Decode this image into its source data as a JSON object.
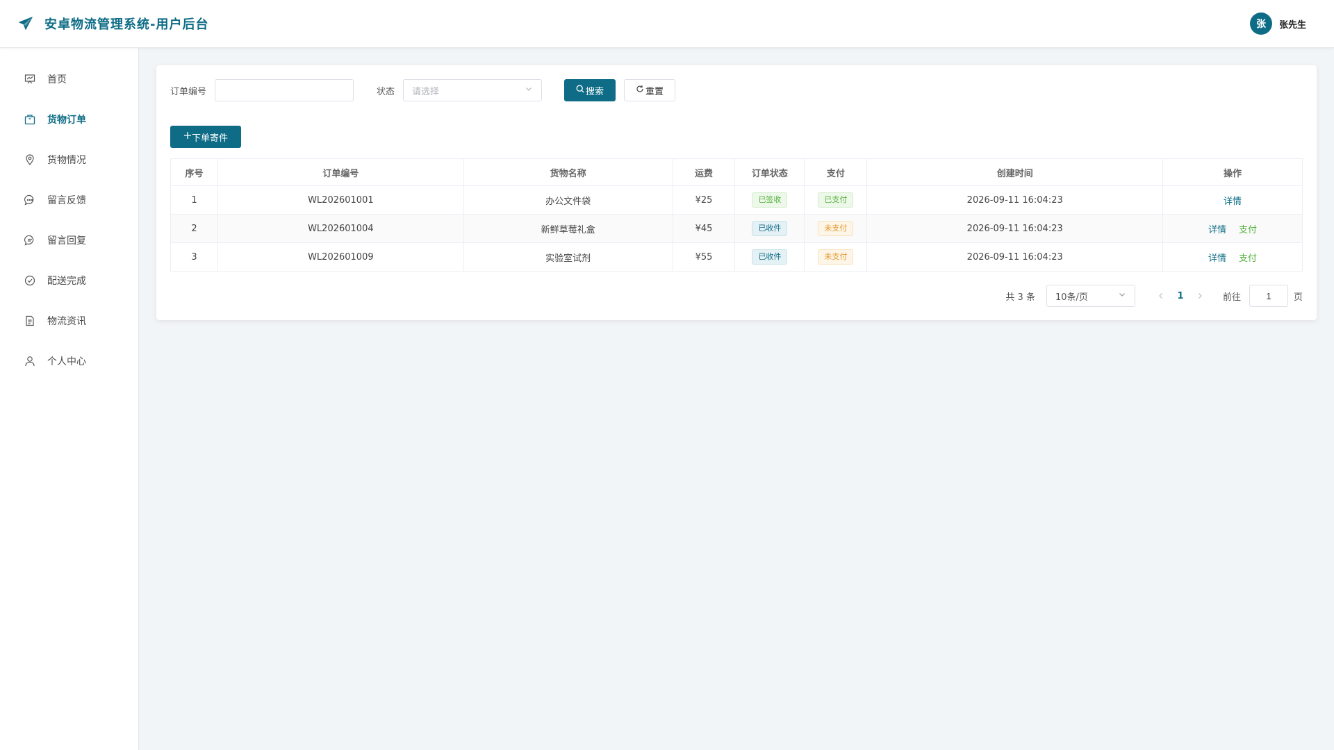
{
  "header": {
    "app_title": "安卓物流管理系统-用户后台",
    "avatar_text": "张",
    "user_name": "张先生"
  },
  "sidebar": {
    "items": [
      {
        "label": "首页",
        "icon": "dashboard-icon",
        "active": false
      },
      {
        "label": "货物订单",
        "icon": "package-icon",
        "active": true
      },
      {
        "label": "货物情况",
        "icon": "location-icon",
        "active": false
      },
      {
        "label": "留言反馈",
        "icon": "chat-icon",
        "active": false
      },
      {
        "label": "留言回复",
        "icon": "reply-icon",
        "active": false
      },
      {
        "label": "配送完成",
        "icon": "check-circle-icon",
        "active": false
      },
      {
        "label": "物流资讯",
        "icon": "document-icon",
        "active": false
      },
      {
        "label": "个人中心",
        "icon": "user-icon",
        "active": false
      }
    ]
  },
  "search": {
    "order_no_label": "订单编号",
    "order_no_value": "",
    "status_label": "状态",
    "status_placeholder": "请选择",
    "search_button": "搜索",
    "reset_button": "重置"
  },
  "add_button": "下单寄件",
  "table": {
    "headers": [
      "序号",
      "订单编号",
      "货物名称",
      "运费",
      "订单状态",
      "支付",
      "创建时间",
      "操作"
    ],
    "rows": [
      {
        "index": "1",
        "order_no": "WL202601001",
        "goods": "办公文件袋",
        "fee": "¥25",
        "status": "已签收",
        "status_color": "green",
        "pay": "已支付",
        "pay_color": "green",
        "created": "2026-09-11 16:04:23",
        "actions": [
          "详情"
        ]
      },
      {
        "index": "2",
        "order_no": "WL202601004",
        "goods": "新鲜草莓礼盒",
        "fee": "¥45",
        "status": "已收件",
        "status_color": "blue",
        "pay": "未支付",
        "pay_color": "orange",
        "created": "2026-09-11 16:04:23",
        "actions": [
          "详情",
          "支付"
        ]
      },
      {
        "index": "3",
        "order_no": "WL202601009",
        "goods": "实验室试剂",
        "fee": "¥55",
        "status": "已收件",
        "status_color": "blue",
        "pay": "未支付",
        "pay_color": "orange",
        "created": "2026-09-11 16:04:23",
        "actions": [
          "详情",
          "支付"
        ]
      }
    ]
  },
  "pagination": {
    "total_text": "共 3 条",
    "page_size": "10条/页",
    "current_page": "1",
    "goto_label": "前往",
    "goto_value": "1",
    "page_unit": "页"
  },
  "colors": {
    "primary": "#0e6c86",
    "success": "#52b03a",
    "warning": "#e49a2e"
  }
}
